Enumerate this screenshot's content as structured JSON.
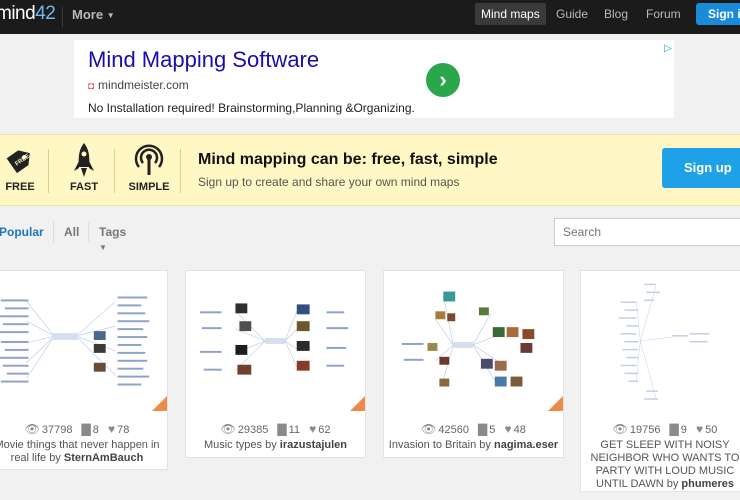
{
  "topbar": {
    "logo_main": "mind",
    "logo_num": "42",
    "more_label": "More",
    "nav": [
      {
        "label": "Mind maps",
        "active": true
      },
      {
        "label": "Guide",
        "active": false
      },
      {
        "label": "Blog",
        "active": false
      },
      {
        "label": "Forum",
        "active": false
      }
    ],
    "signin_label": "Sign in"
  },
  "ad": {
    "title": "Mind Mapping Software",
    "url": "mindmeister.com",
    "description": "No Installation required! Brainstorming,Planning &Organizing.",
    "choices_icon": "adchoices-icon"
  },
  "promo": {
    "items": [
      {
        "label": "FREE",
        "icon": "price-tag-icon"
      },
      {
        "label": "FAST",
        "icon": "rocket-icon"
      },
      {
        "label": "SIMPLE",
        "icon": "broadcast-icon"
      }
    ],
    "headline": "Mind mapping can be: free, fast, simple",
    "subline": "Sign up to create and share your own mind maps",
    "signup_label": "Sign up",
    "tag_text": "FREE"
  },
  "filters": {
    "tabs": [
      "Popular",
      "All",
      "Tags"
    ],
    "active": "Popular",
    "search_placeholder": "Search"
  },
  "colors": {
    "accent": "#1a8bd8",
    "promo_bg": "#fff8c4",
    "corner": "#f08a4b"
  },
  "cards": [
    {
      "views": "37798",
      "comments": "8",
      "likes": "78",
      "title": "Movie things that never happen in real life",
      "by": "by",
      "author": "SternAmBauch"
    },
    {
      "views": "29385",
      "comments": "11",
      "likes": "62",
      "title": "Music types",
      "by": "by",
      "author": "irazustajulen"
    },
    {
      "views": "42560",
      "comments": "5",
      "likes": "48",
      "title": "Invasion to Britain",
      "by": "by",
      "author": "nagima.eser"
    },
    {
      "views": "19756",
      "comments": "9",
      "likes": "50",
      "title": "GET SLEEP WITH NOISY NEIGHBOR WHO WANTS TO PARTY WITH LOUD MUSIC UNTIL DAWN",
      "by": "by",
      "author": "phumeres"
    }
  ]
}
